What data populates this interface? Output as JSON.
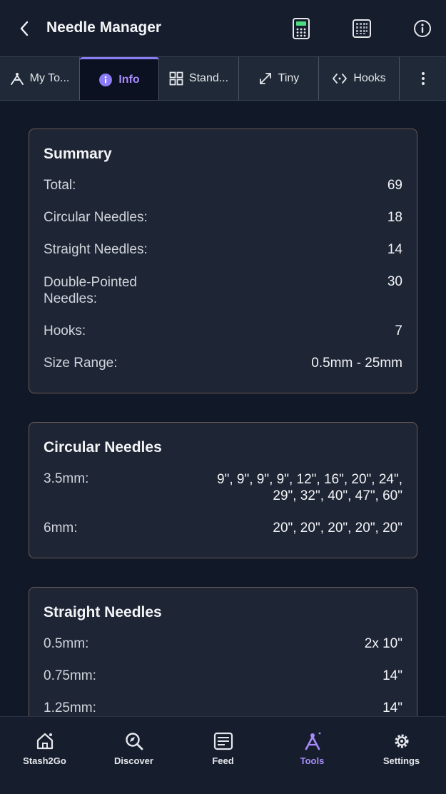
{
  "header": {
    "title": "Needle Manager",
    "icons": [
      "back-icon",
      "calculator-icon",
      "grid-icon",
      "info-circle-icon"
    ]
  },
  "tabs": [
    {
      "label": "My To...",
      "icon": "tools-icon"
    },
    {
      "label": "Info",
      "icon": "info-icon",
      "active": true
    },
    {
      "label": "Stand...",
      "icon": "grid-icon"
    },
    {
      "label": "Tiny",
      "icon": "expand-icon"
    },
    {
      "label": "Hooks",
      "icon": "hook-icon"
    },
    {
      "label": "",
      "icon": "more-vertical-icon"
    }
  ],
  "summary": {
    "title": "Summary",
    "rows": [
      {
        "label": "Total:",
        "value": "69"
      },
      {
        "label": "Circular Needles:",
        "value": "18"
      },
      {
        "label": "Straight Needles:",
        "value": "14"
      },
      {
        "label": "Double-Pointed Needles:",
        "value": "30"
      },
      {
        "label": "Hooks:",
        "value": "7"
      },
      {
        "label": "Size Range:",
        "value": "0.5mm - 25mm"
      }
    ]
  },
  "circular": {
    "title": "Circular Needles",
    "rows": [
      {
        "label": "3.5mm:",
        "value_line1": "9\", 9\", 9\", 9\", 12\", 16\", 20\", 24\",",
        "value_line2": "29\", 32\", 40\", 47\", 60\""
      },
      {
        "label": "6mm:",
        "value": "20\", 20\", 20\", 20\", 20\""
      }
    ]
  },
  "straight": {
    "title": "Straight Needles",
    "rows": [
      {
        "label": "0.5mm:",
        "value": "2x 10\""
      },
      {
        "label": "0.75mm:",
        "value": "14\""
      },
      {
        "label": "1.25mm:",
        "value": "14\""
      }
    ]
  },
  "bottom_nav": [
    {
      "label": "Stash2Go",
      "icon": "home-icon"
    },
    {
      "label": "Discover",
      "icon": "discover-icon"
    },
    {
      "label": "Feed",
      "icon": "feed-icon"
    },
    {
      "label": "Tools",
      "icon": "tools-icon",
      "active": true
    },
    {
      "label": "Settings",
      "icon": "settings-icon"
    }
  ],
  "colors": {
    "accent": "#a78bfa",
    "background": "#111827",
    "card": "#1e2535",
    "card_border": "#6b5a55"
  }
}
